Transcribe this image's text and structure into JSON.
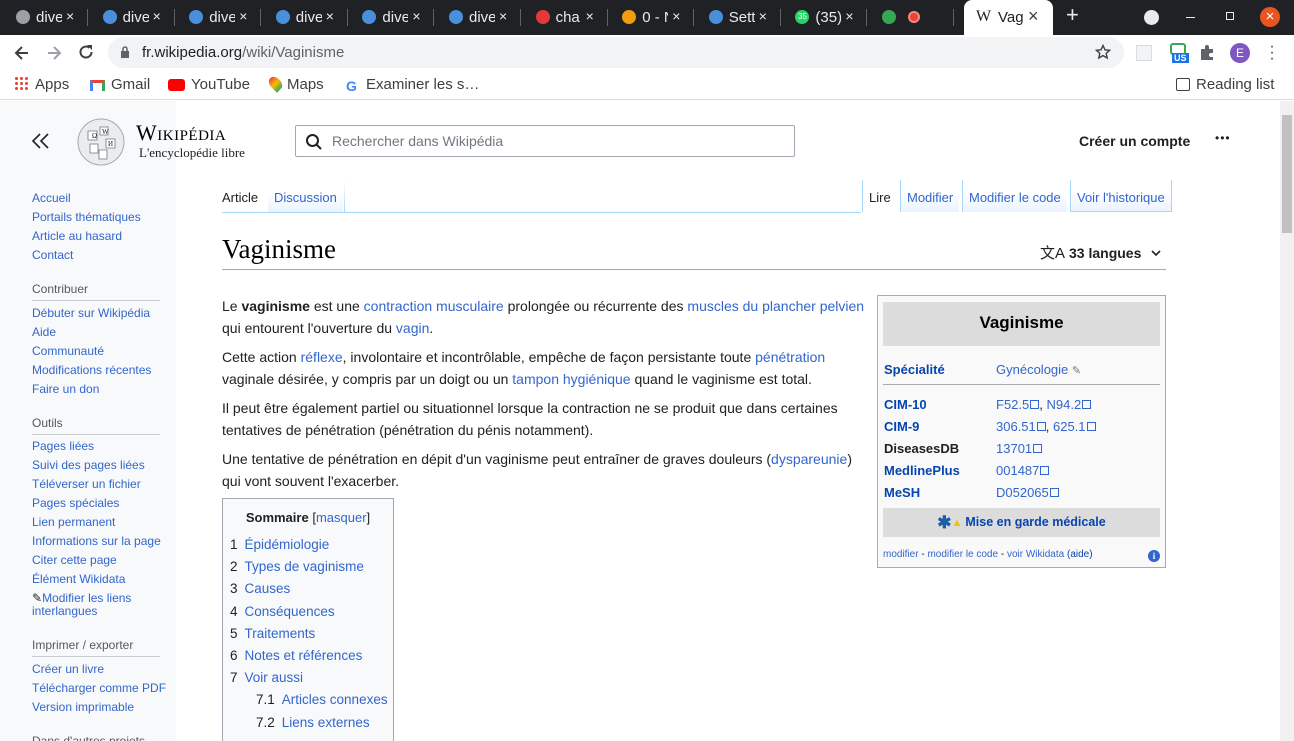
{
  "browser": {
    "tabs": [
      {
        "title": "dive",
        "color": "#9aa0a6"
      },
      {
        "title": "dive",
        "color": "#4a8fdc"
      },
      {
        "title": "dive",
        "color": "#4a8fdc"
      },
      {
        "title": "dive",
        "color": "#4a8fdc"
      },
      {
        "title": "dive",
        "color": "#4a8fdc"
      },
      {
        "title": "dive",
        "color": "#4a8fdc"
      },
      {
        "title": "cha",
        "color": "#e53935"
      },
      {
        "title": "0 - N",
        "color": "#f39c12"
      },
      {
        "title": "Sett",
        "color": "#4a8fdc"
      },
      {
        "title": "(35)",
        "color": "#25d366"
      },
      {
        "title": "",
        "color": "#34a853"
      }
    ],
    "active_tab_title": "Vag",
    "active_tab_favicon": "W",
    "new_tab_label": "+",
    "close_glyph": "×",
    "url_domain": "fr.wikipedia.org",
    "url_path": "/wiki/Vaginisme",
    "whatsapp_badge": "35",
    "profile_initial": "E",
    "ext_badge": "US",
    "bookmarks": [
      {
        "label": "Apps",
        "icon": "apps-grid-icon"
      },
      {
        "label": "Gmail",
        "icon": "gmail-icon"
      },
      {
        "label": "YouTube",
        "icon": "youtube-icon"
      },
      {
        "label": "Maps",
        "icon": "maps-icon"
      },
      {
        "label": "Examiner les s…",
        "icon": "google-icon"
      }
    ],
    "reading_list": "Reading list"
  },
  "header": {
    "wordmark": "Wikipédia",
    "tagline": "L'encyclopédie libre",
    "search_placeholder": "Rechercher dans Wikipédia",
    "create_account": "Créer un compte",
    "more_glyph": "•••"
  },
  "sidebar": {
    "nav": [
      "Accueil",
      "Portails thématiques",
      "Article au hasard",
      "Contact"
    ],
    "contribute_heading": "Contribuer",
    "contribute": [
      "Débuter sur Wikipédia",
      "Aide",
      "Communauté",
      "Modifications récentes",
      "Faire un don"
    ],
    "tools_heading": "Outils",
    "tools": [
      "Pages liées",
      "Suivi des pages liées",
      "Téléverser un fichier",
      "Pages spéciales",
      "Lien permanent",
      "Informations sur la page",
      "Citer cette page",
      "Élément Wikidata"
    ],
    "interlang_line1": "Modifier les liens",
    "interlang_line2": "interlangues",
    "print_heading": "Imprimer / exporter",
    "print": [
      "Créer un livre",
      "Télécharger comme PDF",
      "Version imprimable"
    ],
    "other_heading": "Dans d'autres projets"
  },
  "page_tabs": {
    "left": [
      "Article",
      "Discussion"
    ],
    "right": [
      "Lire",
      "Modifier",
      "Modifier le code",
      "Voir l'historique"
    ]
  },
  "article": {
    "title": "Vaginisme",
    "languages": "33 langues",
    "p1": [
      {
        "t": "Le "
      },
      {
        "t": "vaginisme",
        "b": true
      },
      {
        "t": " est une "
      },
      {
        "t": "contraction musculaire",
        "l": true
      },
      {
        "t": " prolongée ou récurrente des "
      },
      {
        "t": "muscles du plancher pelvien",
        "l": true
      },
      {
        "t": " qui entourent l'ouverture du "
      },
      {
        "t": "vagin",
        "l": true
      },
      {
        "t": "."
      }
    ],
    "p2": [
      {
        "t": "Cette action "
      },
      {
        "t": "réflexe",
        "l": true
      },
      {
        "t": ", involontaire et incontrôlable, empêche de façon persistante toute "
      },
      {
        "t": "pénétration",
        "l": true
      },
      {
        "t": " vaginale désirée, y compris par un doigt ou un "
      },
      {
        "t": "tampon hygiénique",
        "l": true
      },
      {
        "t": " quand le vaginisme est total."
      }
    ],
    "p3": [
      {
        "t": "Il peut être également partiel ou situationnel lorsque la contraction ne se produit que dans certaines tentatives de pénétration (pénétration du pénis notamment)."
      }
    ],
    "p4": [
      {
        "t": "Une tentative de pénétration en dépit d'un vaginisme peut entraîner de graves douleurs ("
      },
      {
        "t": "dyspareunie",
        "l": true
      },
      {
        "t": ") qui vont souvent l'exacerber."
      }
    ]
  },
  "toc": {
    "title": "Sommaire",
    "toggle": "masquer",
    "items": [
      {
        "num": "1",
        "label": "Épidémiologie"
      },
      {
        "num": "2",
        "label": "Types de vaginisme"
      },
      {
        "num": "3",
        "label": "Causes"
      },
      {
        "num": "4",
        "label": "Conséquences"
      },
      {
        "num": "5",
        "label": "Traitements"
      },
      {
        "num": "6",
        "label": "Notes et références"
      },
      {
        "num": "7",
        "label": "Voir aussi"
      },
      {
        "num": "7.1",
        "label": "Articles connexes",
        "sub": true
      },
      {
        "num": "7.2",
        "label": "Liens externes",
        "sub": true
      }
    ]
  },
  "infobox": {
    "title": "Vaginisme",
    "specialty_label": "Spécialité",
    "specialty_value": "Gynécologie",
    "rows": [
      {
        "label": "CIM-10",
        "link": true,
        "values": [
          "F52.5",
          "N94.2"
        ]
      },
      {
        "label": "CIM-9",
        "link": true,
        "values": [
          "306.51",
          "625.1"
        ]
      },
      {
        "label": "DiseasesDB",
        "link": false,
        "values": [
          "13701"
        ]
      },
      {
        "label": "MedlinePlus",
        "link": true,
        "values": [
          "001487"
        ]
      },
      {
        "label": "MeSH",
        "link": true,
        "values": [
          "D052065"
        ]
      }
    ],
    "warning": "Mise en garde médicale",
    "footer_links": [
      "modifier",
      "modifier le code",
      "voir Wikidata"
    ],
    "footer_help": "(aide)"
  }
}
